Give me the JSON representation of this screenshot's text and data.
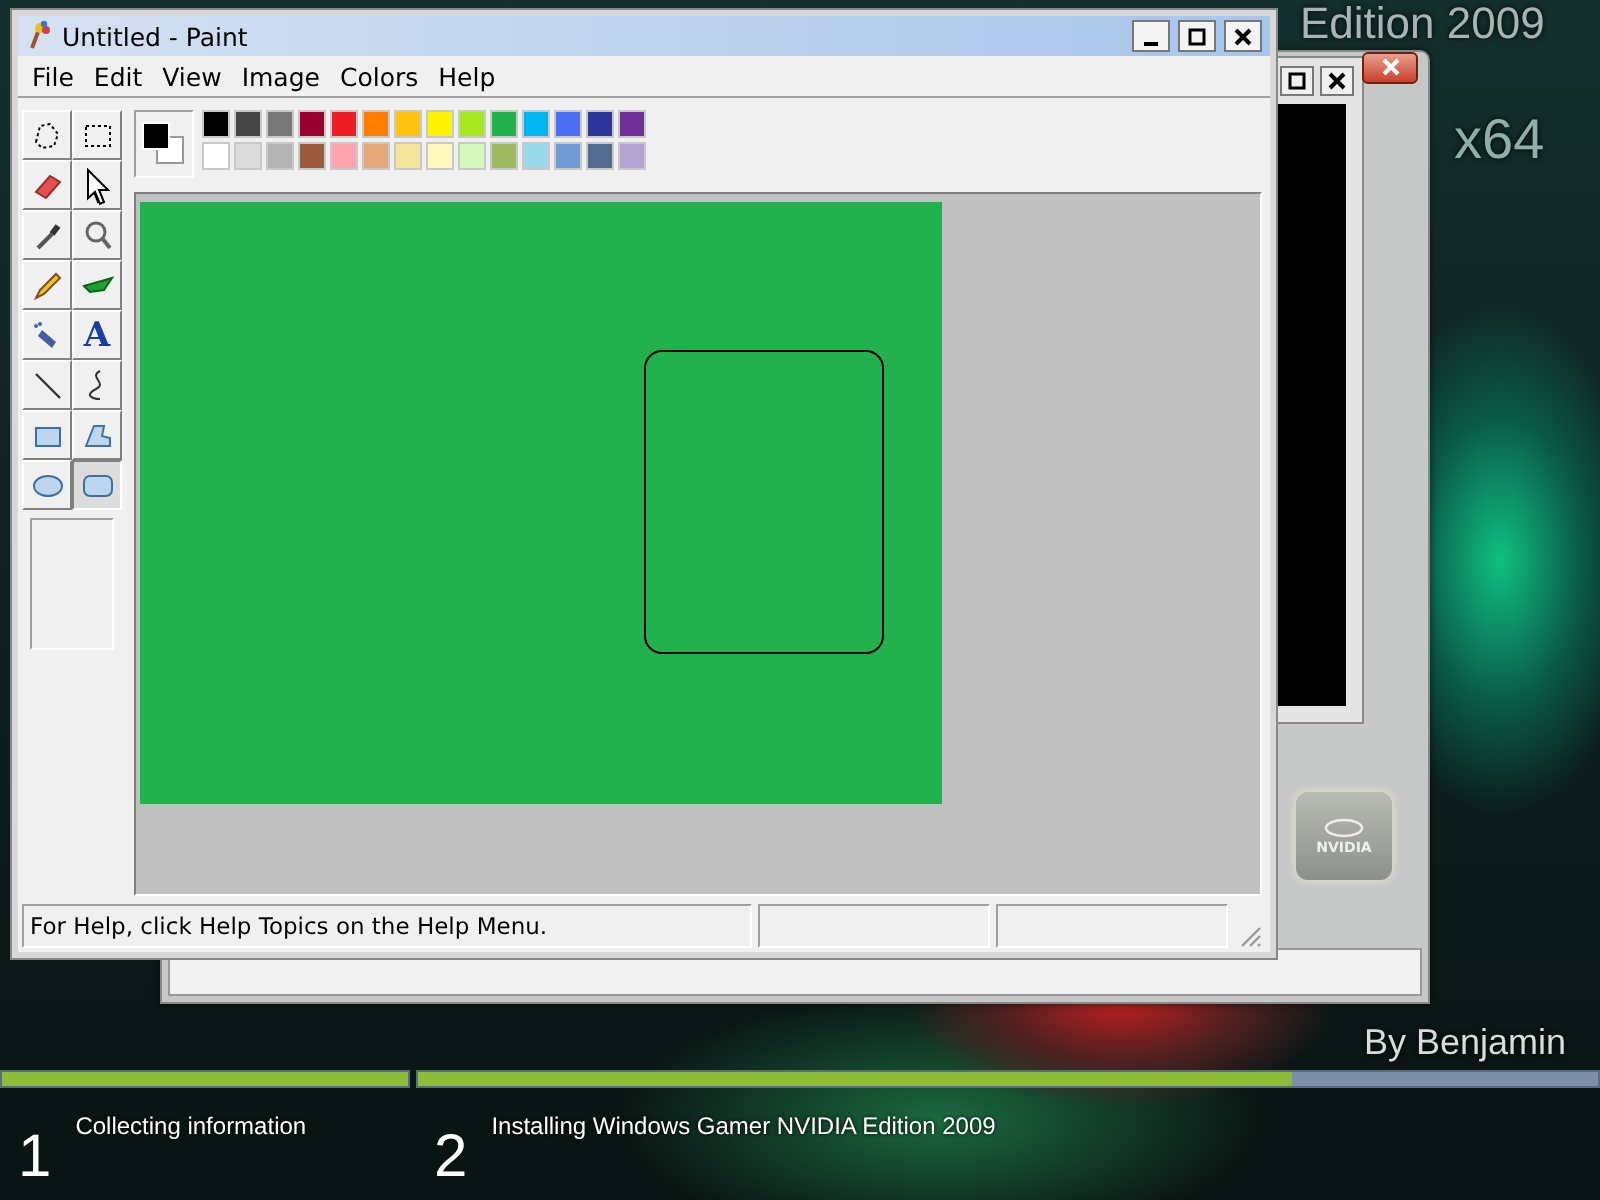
{
  "desktop": {
    "edition_text": "Edition 2009",
    "arch_text": "x64",
    "author_text": "By Benjamin"
  },
  "back_window": {
    "logo_text": "NVIDIA"
  },
  "paint": {
    "title": "Untitled - Paint",
    "menu": [
      "File",
      "Edit",
      "View",
      "Image",
      "Colors",
      "Help"
    ],
    "tools": [
      {
        "kind": "free-select",
        "selected": false
      },
      {
        "kind": "rect-select",
        "selected": false
      },
      {
        "kind": "eraser",
        "selected": false
      },
      {
        "kind": "fill",
        "selected": false
      },
      {
        "kind": "picker",
        "selected": false
      },
      {
        "kind": "magnifier",
        "selected": false
      },
      {
        "kind": "pencil",
        "selected": false
      },
      {
        "kind": "brush",
        "selected": false
      },
      {
        "kind": "airbrush",
        "selected": false
      },
      {
        "kind": "text",
        "glyph": "A",
        "selected": false
      },
      {
        "kind": "line",
        "selected": false
      },
      {
        "kind": "curve",
        "selected": false
      },
      {
        "kind": "rectangle",
        "selected": false
      },
      {
        "kind": "polygon",
        "selected": false
      },
      {
        "kind": "ellipse",
        "selected": false
      },
      {
        "kind": "rounded-rect",
        "selected": true
      }
    ],
    "foreground": {
      "color": "#000000"
    },
    "background": {
      "color": "#ffffff"
    },
    "palette": [
      {
        "color": "#000000"
      },
      {
        "color": "#464646"
      },
      {
        "color": "#787878"
      },
      {
        "color": "#990030"
      },
      {
        "color": "#ed1c24"
      },
      {
        "color": "#ff7e00"
      },
      {
        "color": "#ffc20e"
      },
      {
        "color": "#fff200"
      },
      {
        "color": "#a8e61d"
      },
      {
        "color": "#22b14c"
      },
      {
        "color": "#00b7ef"
      },
      {
        "color": "#4d6df3"
      },
      {
        "color": "#2f3699"
      },
      {
        "color": "#6f3198"
      },
      {
        "color": "#ffffff"
      },
      {
        "color": "#dcdcdc"
      },
      {
        "color": "#b4b4b4"
      },
      {
        "color": "#9c5a3c"
      },
      {
        "color": "#ffa3b1"
      },
      {
        "color": "#e5aa7a"
      },
      {
        "color": "#f5e49c"
      },
      {
        "color": "#fff9bd"
      },
      {
        "color": "#d3f9bc"
      },
      {
        "color": "#9dbb61"
      },
      {
        "color": "#99d9ea"
      },
      {
        "color": "#709ad1"
      },
      {
        "color": "#546d8e"
      },
      {
        "color": "#b5a5d5"
      }
    ],
    "image": {
      "color": "#22b14c"
    },
    "status": {
      "text": "For Help, click Help Topics on the Help Menu."
    }
  },
  "setup": {
    "steps": [
      {
        "number": "1",
        "label": "Collecting information",
        "level": 1
      },
      {
        "number": "2",
        "label": "Installing Windows Gamer NVIDIA Edition 2009",
        "level": 0.74
      }
    ]
  }
}
